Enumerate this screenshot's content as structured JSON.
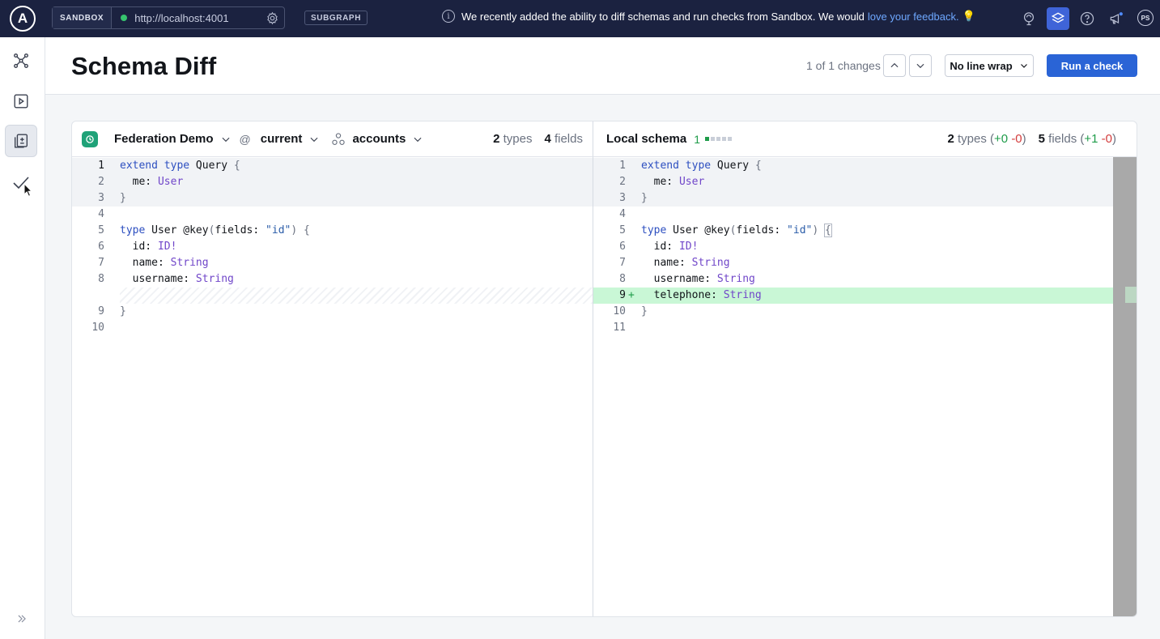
{
  "topbar": {
    "logo_letter": "A",
    "sandbox_label": "SANDBOX",
    "url": "http://localhost:4001",
    "subgraph_label": "SUBGRAPH",
    "banner_text": "We recently added the ability to diff schemas and run checks from Sandbox. We would",
    "banner_link": "love your feedback.",
    "banner_icon": "💡",
    "avatar_initials": "PS"
  },
  "header": {
    "title": "Schema Diff",
    "changes_text": "1 of 1 changes",
    "wrap_label": "No line wrap",
    "run_label": "Run a check"
  },
  "left_pane": {
    "graph_name": "Federation Demo",
    "at": "@",
    "variant": "current",
    "subgraph": "accounts",
    "types_count": "2",
    "types_label": "types",
    "fields_count": "4",
    "fields_label": "fields"
  },
  "right_pane": {
    "title": "Local schema",
    "change_count": "1",
    "types_count": "2",
    "types_label": "types",
    "types_plus": "+0",
    "types_minus": "-0",
    "fields_count": "5",
    "fields_label": "fields",
    "fields_plus": "+1",
    "fields_minus": "-0"
  },
  "colors": {
    "topbar_bg": "#1b2240",
    "primary": "#2a64d6",
    "added_bg": "#c9f7d6",
    "added_text": "#1f9c4a",
    "removed_text": "#d33b3b"
  }
}
